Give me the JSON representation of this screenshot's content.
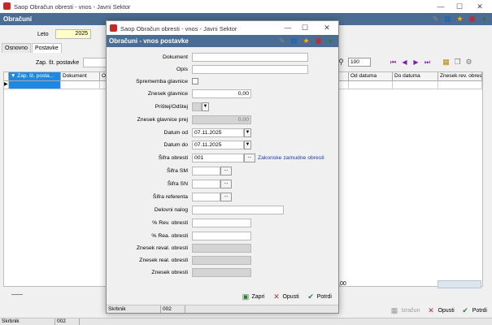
{
  "main": {
    "window_title": "Saop Obračun obresti - vnos - Javni Sektor",
    "header": "Obračuni",
    "leto_label": "Leto",
    "leto_value": "2025",
    "tabs": [
      "Osnovno",
      "Postavke"
    ],
    "zap_label": "Zap. št. postavke",
    "grid_columns": [
      "Zap. št. posta...",
      "Dokument",
      "O",
      "Od datuma",
      "Do datuma",
      "Znesek rev. obresti"
    ],
    "zoom": "100",
    "footer_value": ",00",
    "btn_izracun": "Izračun",
    "btn_opusti": "Opusti",
    "btn_potrdi": "Potrdi",
    "status_user": "Skrbnik",
    "status_code": "002"
  },
  "dialog": {
    "window_title": "Saop Obračun obresti - vnos - Javni Sektor",
    "header": "Obračuni - vnos postavke",
    "fields": {
      "dokument": {
        "label": "Dokument",
        "value": ""
      },
      "opis": {
        "label": "Opis",
        "value": ""
      },
      "sprememba": {
        "label": "Sprememba glavnice"
      },
      "znesek_glavnice": {
        "label": "Znesek glavnice",
        "value": "0,00"
      },
      "pristej": {
        "label": "Prištej/Odštej",
        "value": ""
      },
      "znesek_glavnice_prej": {
        "label": "Znesek glavnice prej",
        "value": "0,00"
      },
      "datum_od": {
        "label": "Datum od",
        "value": "07.11.2025"
      },
      "datum_do": {
        "label": "Datum do",
        "value": "07.11.2025"
      },
      "sifra_obresti": {
        "label": "Šifra obresti",
        "value": "001",
        "link": "Zakonske zamudne obresti"
      },
      "sifra_sm": {
        "label": "Šifra SM",
        "value": ""
      },
      "sifra_sn": {
        "label": "Šifra SN",
        "value": ""
      },
      "sifra_referenta": {
        "label": "Šifra referenta",
        "value": ""
      },
      "delovni_nalog": {
        "label": "Delovni nalog",
        "value": ""
      },
      "rev_obresti": {
        "label": "% Rev. obresti",
        "value": ""
      },
      "rea_obresti": {
        "label": "% Rea. obresti",
        "value": ""
      },
      "znesek_reval": {
        "label": "Znesek reval. obresti",
        "value": ""
      },
      "znesek_real": {
        "label": "Znesek real. obresti",
        "value": ""
      },
      "znesek_obresti": {
        "label": "Znesek obresti",
        "value": ""
      }
    },
    "btn_zapri": "Zapri",
    "btn_opusti": "Opusti",
    "btn_potrdi": "Potrdi",
    "status_user": "Skrbnik",
    "status_code": "002"
  }
}
